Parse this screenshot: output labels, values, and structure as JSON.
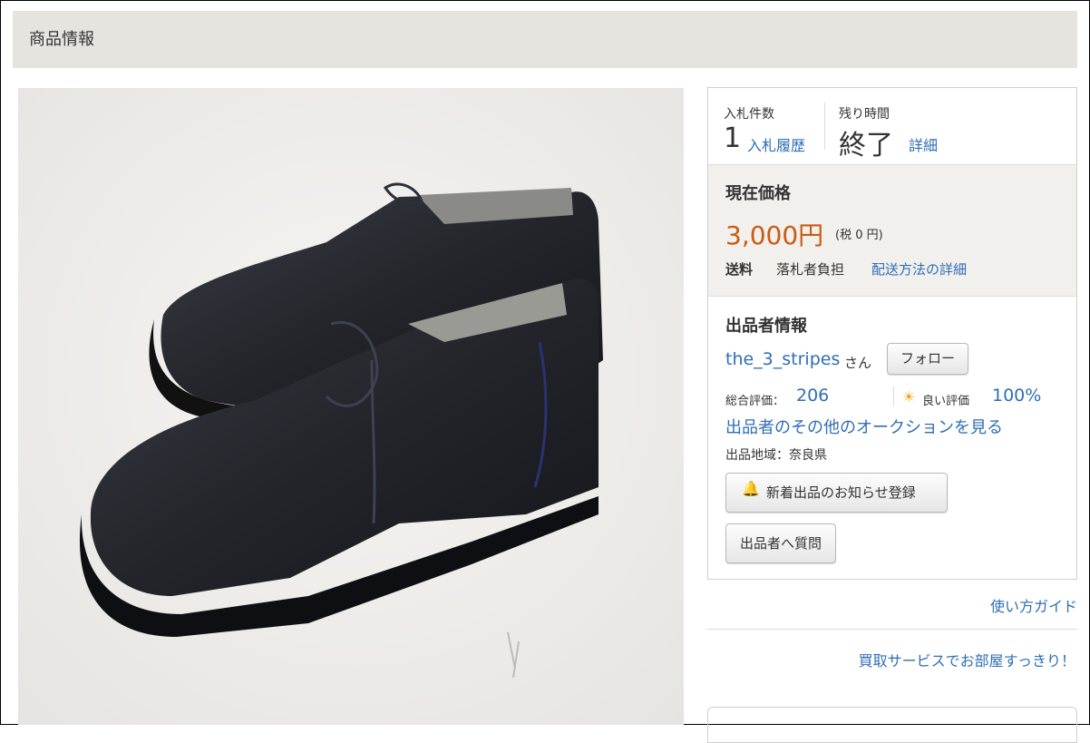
{
  "section": {
    "title": "商品情報"
  },
  "photo": {
    "alt": "black leather chukka boots"
  },
  "bids": {
    "count_label": "入札件数",
    "count_value": "1",
    "history_link": "入札履歴",
    "time_label": "残り時間",
    "time_value": "終了",
    "detail_link": "詳細"
  },
  "price": {
    "title": "現在価格",
    "value": "3,000円",
    "tax": "(税 0 円)",
    "shipping_label": "送料",
    "shipping_payer": "落札者負担",
    "shipping_link": "配送方法の詳細"
  },
  "seller": {
    "title": "出品者情報",
    "name": "the_3_stripes",
    "honorific": "さん",
    "follow_button": "フォロー",
    "rating_label": "総合評価：",
    "rating_value": "206",
    "good_label": "良い評価",
    "good_value": "100%",
    "other_auctions_link": "出品者のその他のオークションを見る",
    "region": "出品地域：奈良県",
    "notify_button": "新着出品のお知らせ登録",
    "question_button": "出品者へ質問"
  },
  "links": {
    "guide": "使い方ガイド",
    "promo": "買取サービスでお部屋すっきり！"
  },
  "colors": {
    "accent_link": "#2f6eb5",
    "price": "#c95b14",
    "header_bg": "#e5e4df",
    "price_box_bg": "#f1f0ec"
  },
  "icons": {
    "notify": "bell-icon",
    "good_rating": "sun-icon"
  }
}
